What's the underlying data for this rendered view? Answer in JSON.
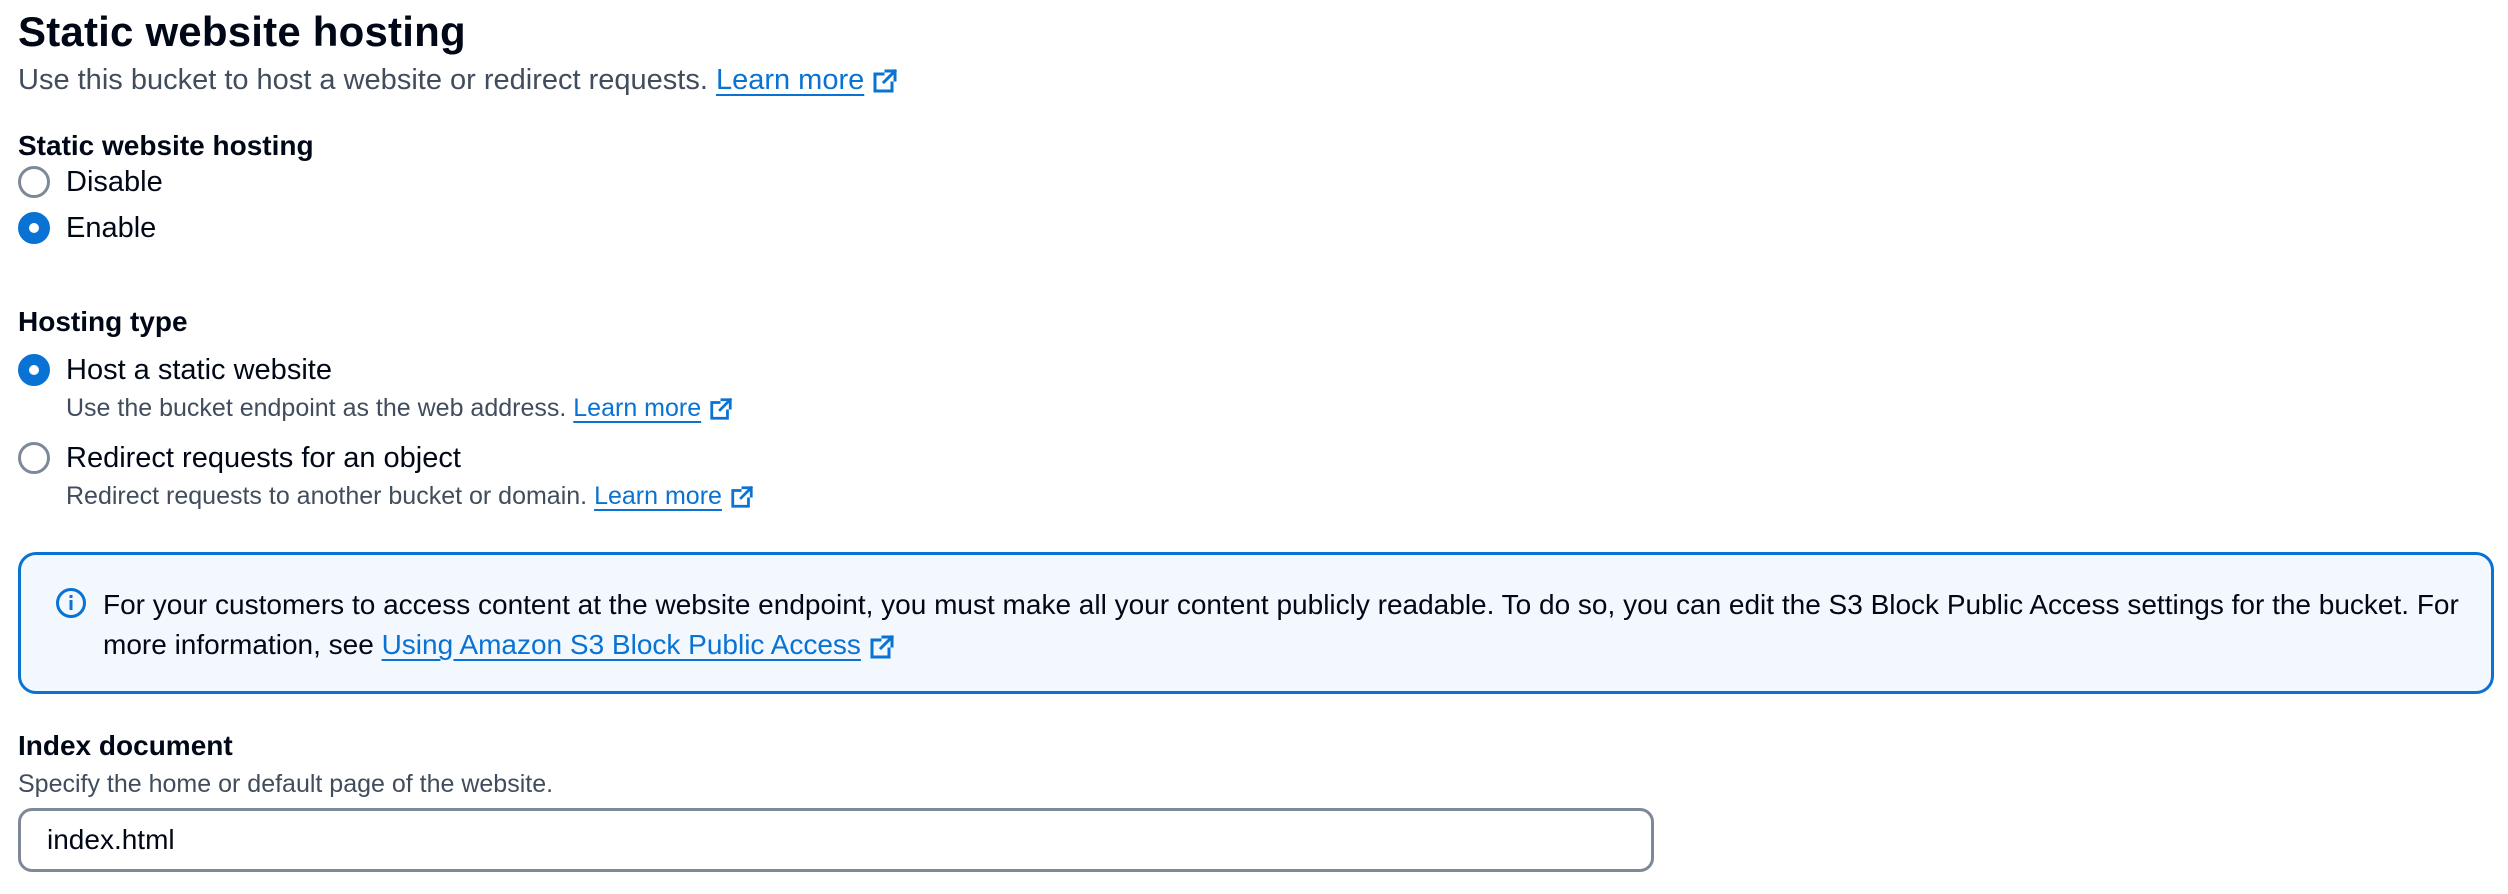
{
  "header": {
    "title": "Static website hosting",
    "description": "Use this bucket to host a website or redirect requests.",
    "learn_more": "Learn more"
  },
  "hosting": {
    "label": "Static website hosting",
    "options": [
      {
        "label": "Disable",
        "selected": false
      },
      {
        "label": "Enable",
        "selected": true
      }
    ]
  },
  "hosting_type": {
    "label": "Hosting type",
    "options": [
      {
        "label": "Host a static website",
        "description": "Use the bucket endpoint as the web address.",
        "learn_more": "Learn more",
        "selected": true
      },
      {
        "label": "Redirect requests for an object",
        "description": "Redirect requests to another bucket or domain.",
        "learn_more": "Learn more",
        "selected": false
      }
    ]
  },
  "alert": {
    "text": "For your customers to access content at the website endpoint, you must make all your content publicly readable. To do so, you can edit the S3 Block Public Access settings for the bucket. For more information, see",
    "link": "Using Amazon S3 Block Public Access",
    "icon": "info-icon"
  },
  "index_document": {
    "label": "Index document",
    "description": "Specify the home or default page of the website.",
    "value": "index.html"
  },
  "colors": {
    "accent": "#0972d3",
    "alert_bg": "#f2f8fd",
    "text": "#000716",
    "secondary_text": "#414d5c"
  }
}
